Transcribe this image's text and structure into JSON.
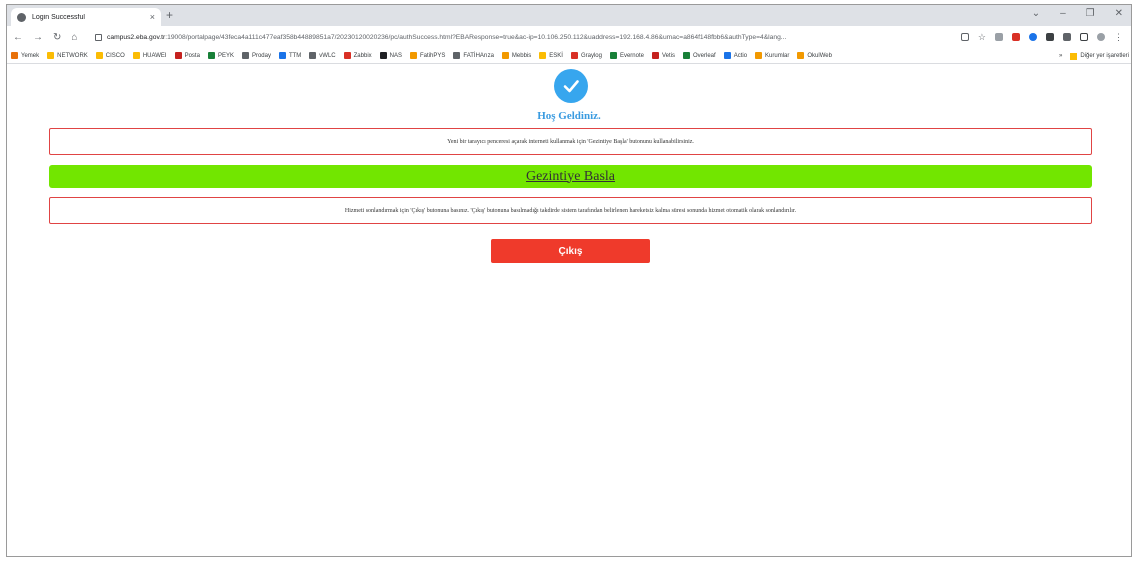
{
  "tab": {
    "title": "Login Successful",
    "close": "×",
    "new": "+"
  },
  "window": {
    "minimize": "–",
    "restore": "❐",
    "close": "✕",
    "dropdown": "⌄"
  },
  "address": {
    "host": "campus2.eba.gov.tr",
    "path": ":19008/portalpage/43feca4a111c477eaf358b44889851a7/20230120020236/pc/authSuccess.html?EBAResponse=true&ac-ip=10.106.250.112&uaddress=192.168.4.86&umac=a864f148fbb6&authType=4&lang..."
  },
  "bookmarks": [
    {
      "label": "Yemek",
      "color": "#e8710a"
    },
    {
      "label": "NETWORK",
      "color": "#fbbc04"
    },
    {
      "label": "CISCO",
      "color": "#fbbc04"
    },
    {
      "label": "HUAWEI",
      "color": "#fbbc04"
    },
    {
      "label": "Posta",
      "color": "#c5221f"
    },
    {
      "label": "PEYK",
      "color": "#188038"
    },
    {
      "label": "Proday",
      "color": "#5f6368"
    },
    {
      "label": "TTM",
      "color": "#1a73e8"
    },
    {
      "label": "vWLC",
      "color": "#5f6368"
    },
    {
      "label": "Zabbix",
      "color": "#d93025"
    },
    {
      "label": "NAS",
      "color": "#202124"
    },
    {
      "label": "FatihPYS",
      "color": "#f29900"
    },
    {
      "label": "FATİHArıza",
      "color": "#5f6368"
    },
    {
      "label": "Mebbis",
      "color": "#f29900"
    },
    {
      "label": "ESKİ",
      "color": "#fbbc04"
    },
    {
      "label": "Graylog",
      "color": "#d93025"
    },
    {
      "label": "Evernote",
      "color": "#188038"
    },
    {
      "label": "Vetis",
      "color": "#c5221f"
    },
    {
      "label": "Overleaf",
      "color": "#188038"
    },
    {
      "label": "Actio",
      "color": "#1a73e8"
    },
    {
      "label": "Kurumlar",
      "color": "#f29900"
    },
    {
      "label": "OkulWeb",
      "color": "#f29900"
    }
  ],
  "bookmarks_more": "»",
  "bookmarks_other": "Diğer yer işaretleri",
  "page": {
    "welcome": "Hoş Geldiniz.",
    "info_top": "Yeni bir tarayıcı penceresi açarak interneti kullanmak için 'Gezintiye Başla' butonunu kullanabilirsiniz.",
    "start_label": "Gezintiye Basla",
    "info_bottom": "Hizmeti sonlandırmak için 'Çıkış' butonuna basınız. 'Çıkış' butonuna basılmadığı takdirde sistem tarafından belirlenen hareketsiz kalma süresi sonunda hizmet otomatik olarak sonlandırılır.",
    "exit_label": "Çıkış"
  },
  "colors": {
    "check": "#37a6ee",
    "welcome": "#3a9be0",
    "start_bg": "#72e600",
    "exit_bg": "#ef3a2b",
    "box_border": "#e04444"
  }
}
